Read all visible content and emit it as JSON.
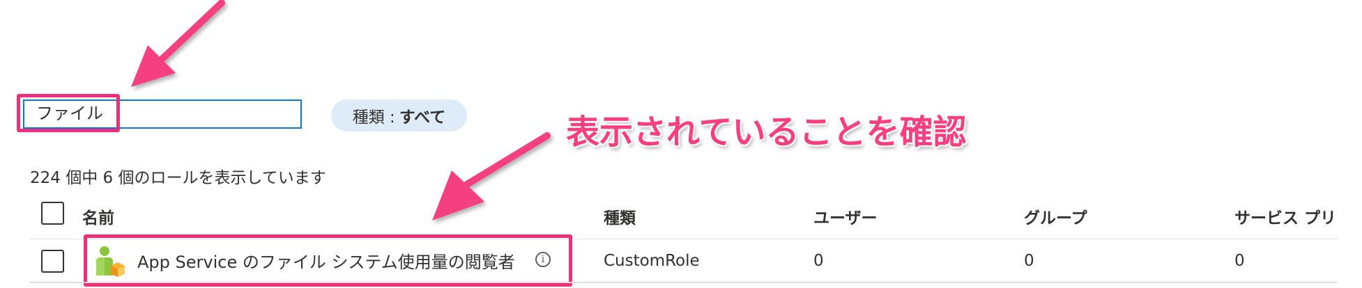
{
  "search": {
    "value": "ファイル"
  },
  "filter": {
    "key": "種類 :",
    "value": "すべて"
  },
  "results_count": "224 個中 6 個のロールを表示しています",
  "annotation": {
    "text": "表示されていることを確認",
    "color": "#f53f7f"
  },
  "table": {
    "headers": {
      "name": "名前",
      "type": "種類",
      "users": "ユーザー",
      "groups": "グループ",
      "service_principals": "サービス プリ"
    },
    "rows": [
      {
        "name": "App Service のファイル システム使用量の閲覧者",
        "type": "CustomRole",
        "users": "0",
        "groups": "0",
        "service_principals": "0",
        "icon": "role-user-icon"
      }
    ]
  },
  "colors": {
    "accent": "#0078d4",
    "highlight": "#f02f7a",
    "pill": "#deecf9"
  }
}
